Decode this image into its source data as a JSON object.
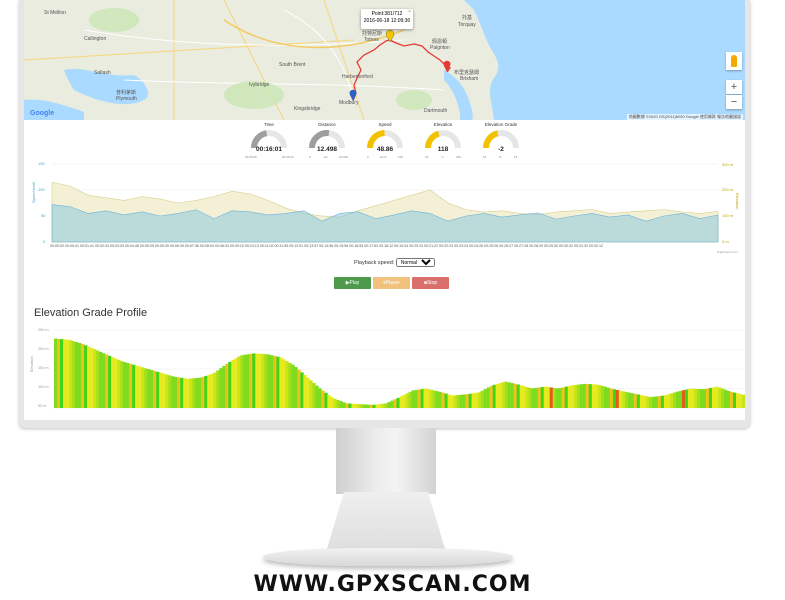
{
  "map": {
    "tooltip": {
      "point": "Point:381/712",
      "time": "2016-06-18 12:09:36",
      "close": "×"
    },
    "zoom_in": "+",
    "zoom_out": "−",
    "google": "Google",
    "attribution": "地圖數據 ©2020 GS(2011)6020 Google   使用條款   報告地圖錯誤",
    "labels": [
      {
        "text": "St Mellion"
      },
      {
        "text": "Callington"
      },
      {
        "text": "Saltash"
      },
      {
        "text": "Plymouth"
      },
      {
        "text": "普利茅斯"
      },
      {
        "text": "Ivybridge"
      },
      {
        "text": "Totnes"
      },
      {
        "text": "托特尼斯"
      },
      {
        "text": "Paignton"
      },
      {
        "text": "佩恩頓"
      },
      {
        "text": "Brixham"
      },
      {
        "text": "布里克瑟姆"
      },
      {
        "text": "Torquay"
      },
      {
        "text": "托基"
      },
      {
        "text": "South Brent"
      },
      {
        "text": "Modbury"
      },
      {
        "text": "Kingsbridge"
      },
      {
        "text": "Dartmouth"
      },
      {
        "text": "Harbertonford"
      }
    ]
  },
  "gauges": [
    {
      "title": "Time",
      "value": "00:16:01",
      "min": "00:00:00",
      "max": "00:36:00",
      "unit": "",
      "fraction": 0.45,
      "color": "#9e9e9e"
    },
    {
      "title": "Distance",
      "value": "12.498",
      "min": "0",
      "max": "22.991",
      "unit": "km",
      "fraction": 0.54,
      "color": "#9e9e9e"
    },
    {
      "title": "Speed",
      "value": "48.86",
      "min": "0",
      "max": "100",
      "unit": "km/h",
      "fraction": 0.49,
      "color": "#f2c200"
    },
    {
      "title": "Elevation",
      "value": "118",
      "min": "40",
      "max": "230",
      "unit": "m",
      "fraction": 0.41,
      "color": "#f2c200"
    },
    {
      "title": "Elevation Grade",
      "value": "-2",
      "min": "-15",
      "max": "15",
      "unit": "%",
      "fraction": 0.43,
      "color": "#f2c200"
    }
  ],
  "chart_data": [
    {
      "type": "area",
      "title": "",
      "xlabel": "",
      "ylabel_left": "Speed km/h",
      "ylabel_right": "Elevation",
      "ylim_left": [
        0,
        150
      ],
      "ylim_right": [
        0,
        300
      ],
      "yticks_left": [
        "150",
        "100",
        "50",
        "0"
      ],
      "yticks_right": [
        "300 m",
        "200 m",
        "100 m",
        "0 m"
      ],
      "x_ticks": [
        "00:00:00",
        "00:00:41",
        "00:01:41",
        "00:02:34",
        "00:03:29",
        "00:04:48",
        "00:05:39",
        "00:05:39",
        "00:06:39",
        "00:07:36",
        "00:08:04",
        "00:08:34",
        "00:09:10",
        "00:10:13",
        "00:11:02",
        "00:11:55",
        "00:12:51",
        "00:13:57",
        "00:14:56",
        "00:15:56",
        "00:16:55",
        "00:17:53",
        "00:18:12",
        "00:19:24",
        "00:20:24",
        "00:21:22",
        "00:22:23",
        "00:23:24",
        "00:24:26",
        "00:25:26",
        "00:26:27",
        "00:27:28",
        "00:28:29",
        "00:29:30",
        "00:30:32",
        "00:31:32",
        "00:32:12"
      ],
      "series": [
        {
          "name": "Speed km/h",
          "axis": "left",
          "values": [
            72,
            68,
            55,
            60,
            52,
            58,
            50,
            55,
            62,
            45,
            60,
            58,
            52,
            55,
            60,
            40,
            55,
            58,
            45,
            52,
            60,
            55,
            40,
            50,
            55,
            48,
            52,
            56,
            44,
            50,
            55,
            48,
            52,
            40,
            50,
            55,
            45,
            52
          ]
        },
        {
          "name": "Elevation",
          "axis": "right",
          "values": [
            230,
            215,
            180,
            170,
            160,
            175,
            165,
            150,
            160,
            175,
            195,
            185,
            160,
            130,
            110,
            100,
            95,
            120,
            140,
            160,
            180,
            200,
            150,
            125,
            115,
            120,
            110,
            105,
            115,
            120,
            125,
            110,
            115,
            120,
            125,
            115,
            110,
            118
          ]
        }
      ],
      "credits": "Highcharts.com"
    },
    {
      "type": "area",
      "title": "Elevation Grade Profile",
      "ylabel": "Elevation",
      "yticks": [
        "250 m",
        "200 m",
        "150 m",
        "100 m",
        "50 m"
      ],
      "ylim": [
        50,
        250
      ],
      "values": [
        228,
        225,
        215,
        200,
        185,
        170,
        160,
        150,
        140,
        130,
        125,
        128,
        140,
        165,
        185,
        190,
        188,
        180,
        160,
        130,
        100,
        75,
        62,
        60,
        58,
        62,
        78,
        95,
        100,
        92,
        82,
        85,
        90,
        108,
        118,
        110,
        100,
        105,
        100,
        108,
        112,
        110,
        100,
        92,
        85,
        78,
        82,
        92,
        100,
        98,
        105,
        92,
        84
      ]
    }
  ],
  "playback": {
    "label": "Playback speed:",
    "selected": "Normal"
  },
  "buttons": {
    "play": "▶Play",
    "pause": "⏸Pause",
    "stop": "■Stop"
  },
  "website": "WWW.GPXSCAN.COM"
}
